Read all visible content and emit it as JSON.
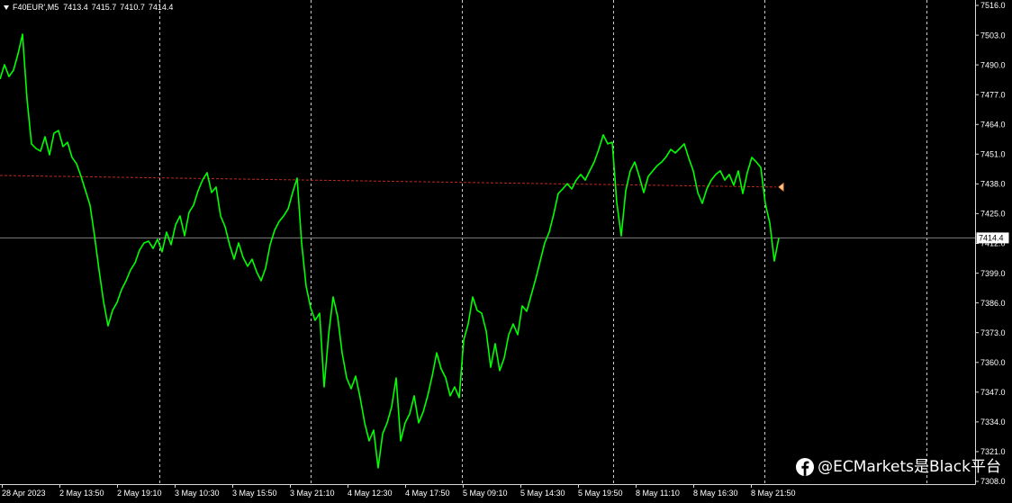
{
  "header": {
    "menu_icon": "triangle-down-icon",
    "symbol": "F40EUR',M5",
    "open": "7413.4",
    "high": "7415.7",
    "low": "7410.7",
    "close": "7414.4"
  },
  "watermark": {
    "icon": "facebook-icon",
    "text": "@ECMarkets是Black平台"
  },
  "chart_data": {
    "type": "line",
    "grid": false,
    "period_separators": true,
    "ylim": [
      7308.0,
      7516.0
    ],
    "y_ticks": [
      "7516.0",
      "7503.0",
      "7490.0",
      "7477.0",
      "7464.0",
      "7451.0",
      "7438.0",
      "7425.0",
      "7412.0",
      "7399.0",
      "7386.0",
      "7373.0",
      "7360.0",
      "7347.0",
      "7334.0",
      "7321.0",
      "7308.0"
    ],
    "x_ticks": [
      "28 Apr 2023",
      "2 May 13:50",
      "2 May 19:10",
      "3 May 10:30",
      "3 May 15:50",
      "3 May 21:10",
      "4 May 12:30",
      "4 May 17:50",
      "5 May 09:10",
      "5 May 14:30",
      "5 May 19:50",
      "8 May 11:10",
      "8 May 16:30",
      "8 May 21:50"
    ],
    "bid_price": 7414.4,
    "reference_line": {
      "start": 7441.7,
      "end": 7436.6
    },
    "values": [
      7483.8,
      7490.1,
      7484.9,
      7487.7,
      7494.8,
      7503.4,
      7475.1,
      7455.5,
      7453.5,
      7452.3,
      7458.6,
      7450.7,
      7460.2,
      7461.3,
      7454.3,
      7456.2,
      7449.6,
      7446.8,
      7441.3,
      7435.0,
      7428.7,
      7415.3,
      7400.4,
      7386.6,
      7376.0,
      7382.7,
      7386.2,
      7391.8,
      7395.7,
      7400.4,
      7403.5,
      7409.1,
      7412.2,
      7413.0,
      7409.8,
      7413.8,
      7408.3,
      7416.9,
      7411.4,
      7420.1,
      7424.0,
      7415.3,
      7425.6,
      7428.7,
      7435.0,
      7439.7,
      7442.9,
      7434.2,
      7436.6,
      7424.0,
      7419.3,
      7411.4,
      7405.1,
      7412.2,
      7405.9,
      7402.0,
      7405.1,
      7399.6,
      7395.7,
      7401.2,
      7411.4,
      7417.7,
      7421.6,
      7424.0,
      7427.1,
      7434.2,
      7440.5,
      7412.2,
      7393.3,
      7383.9,
      7378.4,
      7381.5,
      7349.3,
      7372.1,
      7388.6,
      7380.0,
      7364.2,
      7353.2,
      7348.5,
      7354.0,
      7344.6,
      7333.6,
      7325.7,
      7330.4,
      7313.9,
      7328.8,
      7333.6,
      7340.6,
      7353.2,
      7325.7,
      7333.6,
      7337.5,
      7345.4,
      7333.6,
      7338.3,
      7345.4,
      7354.0,
      7364.2,
      7357.2,
      7353.2,
      7345.4,
      7349.3,
      7344.6,
      7369.7,
      7376.8,
      7388.6,
      7382.7,
      7381.5,
      7373.7,
      7357.9,
      7368.2,
      7356.4,
      7361.9,
      7372.1,
      7376.8,
      7372.1,
      7384.7,
      7382.3,
      7389.4,
      7396.5,
      7404.3,
      7412.2,
      7416.9,
      7424.8,
      7433.8,
      7435.8,
      7438.1,
      7435.8,
      7439.7,
      7442.1,
      7439.7,
      7443.7,
      7447.6,
      7453.1,
      7459.4,
      7455.5,
      7456.2,
      7429.9,
      7415.3,
      7435.0,
      7443.7,
      7447.6,
      7441.3,
      7434.2,
      7441.3,
      7443.7,
      7446.0,
      7447.6,
      7449.9,
      7453.1,
      7451.5,
      7453.5,
      7455.5,
      7449.2,
      7443.7,
      7434.2,
      7429.5,
      7435.8,
      7439.7,
      7442.1,
      7443.7,
      7439.7,
      7442.1,
      7437.4,
      7443.7,
      7433.8,
      7442.9,
      7449.6,
      7447.6,
      7445.2,
      7429.5,
      7420.9,
      7404.3,
      7414.4
    ],
    "colors": {
      "background": "#000000",
      "series": "#00ff00",
      "text": "#ffffff",
      "axis": "#d8d8d8",
      "separator": "#c8c8c8",
      "reference_line": "#c0281e",
      "marker_fill": "#ffd2a8",
      "marker_stroke": "#ff8c3c",
      "bid_line": "#808080",
      "bid_box": "#ffffff",
      "bid_text": "#000000"
    }
  }
}
